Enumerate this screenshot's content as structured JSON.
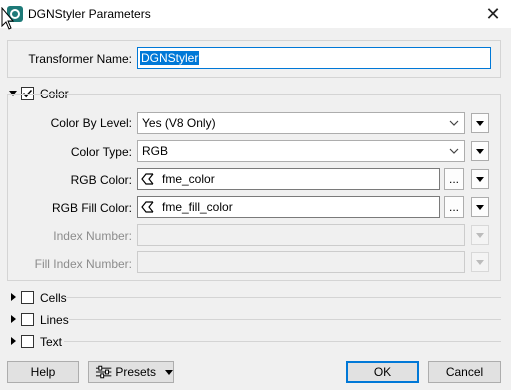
{
  "window": {
    "title": "DGNStyler Parameters",
    "close_glyph": "✕",
    "icon": "app-icon"
  },
  "transformer_name": {
    "label": "Transformer Name:",
    "value": "DGNStyler"
  },
  "color_section": {
    "label": "Color",
    "checked": true,
    "expanded": true,
    "fields": {
      "color_by_level": {
        "label": "Color By Level:",
        "value": "Yes (V8 Only)"
      },
      "color_type": {
        "label": "Color Type:",
        "value": "RGB"
      },
      "rgb_color": {
        "label": "RGB Color:",
        "value": "fme_color"
      },
      "rgb_fill_color": {
        "label": "RGB Fill Color:",
        "value": "fme_fill_color"
      },
      "index_number": {
        "label": "Index Number:",
        "value": ""
      },
      "fill_index_number": {
        "label": "Fill Index Number:",
        "value": ""
      }
    },
    "ellipsis": "..."
  },
  "sections": [
    {
      "label": "Cells",
      "checked": false,
      "expanded": false
    },
    {
      "label": "Lines",
      "checked": false,
      "expanded": false
    },
    {
      "label": "Text",
      "checked": false,
      "expanded": false
    }
  ],
  "buttons": {
    "help": "Help",
    "presets": "Presets",
    "ok": "OK",
    "cancel": "Cancel"
  },
  "colors": {
    "accent": "#0078d7",
    "window_bg": "#f0f0f0",
    "disabled_text": "#8c8c8c"
  }
}
